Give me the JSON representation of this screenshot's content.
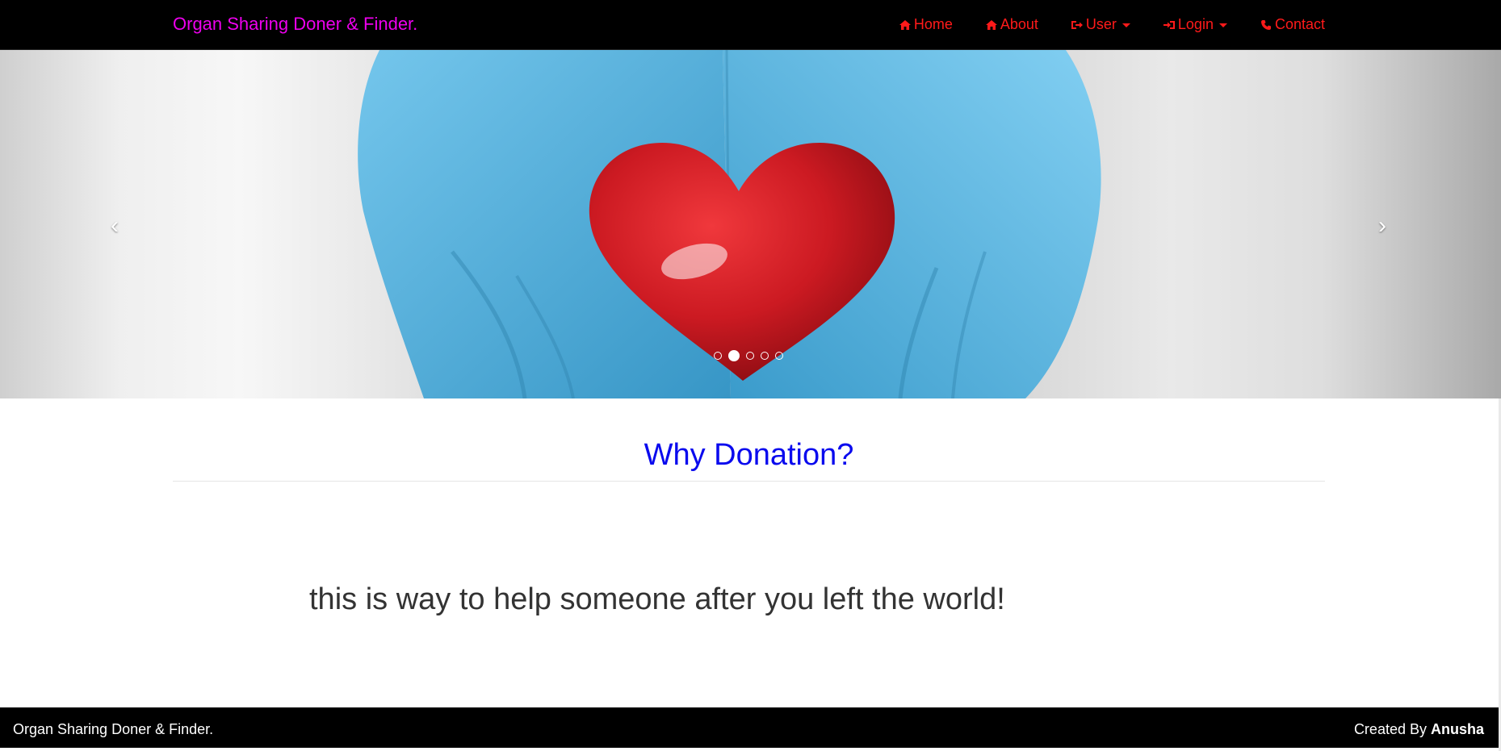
{
  "colors": {
    "navbar_bg": "#000000",
    "brand": "#ee00ee",
    "nav_link": "#ff1a1a",
    "heading": "#0a0aee",
    "body_text": "#333333",
    "footer_bg": "#000000",
    "footer_text": "#ffffff"
  },
  "navbar": {
    "brand": "Organ Sharing Doner & Finder.",
    "items": [
      {
        "label": "Home",
        "icon": "home-icon",
        "dropdown": false
      },
      {
        "label": "About",
        "icon": "home-icon",
        "dropdown": false
      },
      {
        "label": "User",
        "icon": "sign-out-icon",
        "dropdown": true
      },
      {
        "label": "Login",
        "icon": "sign-in-icon",
        "dropdown": true
      },
      {
        "label": "Contact",
        "icon": "phone-icon",
        "dropdown": false
      }
    ]
  },
  "carousel": {
    "prev_label": "‹",
    "next_label": "›",
    "slide_count": 5,
    "active_index": 1,
    "image": "gloved-hands-holding-red-heart"
  },
  "main": {
    "heading": "Why Donation?",
    "text": "this is way to help someone after you left the world!"
  },
  "footer": {
    "left": "Organ Sharing Doner & Finder.",
    "created_by_prefix": "Created By",
    "author": "Anusha"
  }
}
